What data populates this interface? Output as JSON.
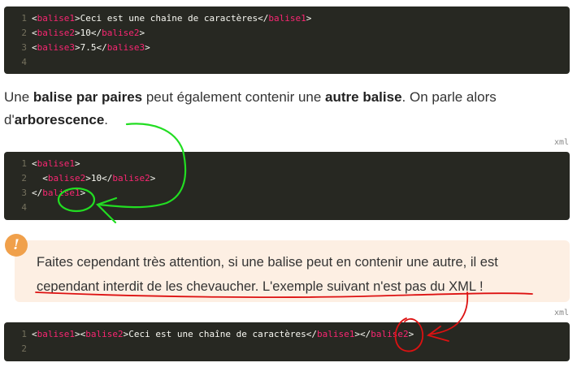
{
  "code1": {
    "lines": [
      {
        "n": "1",
        "open": "balise1",
        "text": "Ceci est une chaîne de caractères",
        "close": "balise1"
      },
      {
        "n": "2",
        "open": "balise2",
        "text": "10",
        "close": "balise2"
      },
      {
        "n": "3",
        "open": "balise3",
        "text": "7.5",
        "close": "balise3"
      },
      {
        "n": "4"
      }
    ]
  },
  "paragraph": {
    "t1": "Une ",
    "b1": "balise par paires",
    "t2": " peut également contenir une ",
    "b2": "autre balise",
    "t3": ". On parle alors d'",
    "b3": "arborescence",
    "t4": "."
  },
  "code2": {
    "lang": "xml",
    "l1n": "1",
    "l1": "balise1",
    "l2n": "2",
    "l2open": "balise2",
    "l2text": "10",
    "l2close": "balise2",
    "l3n": "3",
    "l3": "balise1",
    "l4n": "4"
  },
  "warning": {
    "icon": "exclamation-icon",
    "text": "Faites cependant très attention, si une balise peut en contenir une autre, il est cependant interdit de les chevaucher. L'exemple suivant n'est pas du XML !"
  },
  "code3": {
    "lang": "xml",
    "l1n": "1",
    "a": "balise1",
    "b": "balise2",
    "text": "Ceci est une chaîne de caractères",
    "c": "balise1",
    "d": "balise2",
    "l2n": "2"
  },
  "annotation_colors": {
    "green": "#22dd22",
    "red": "#dd1111"
  }
}
